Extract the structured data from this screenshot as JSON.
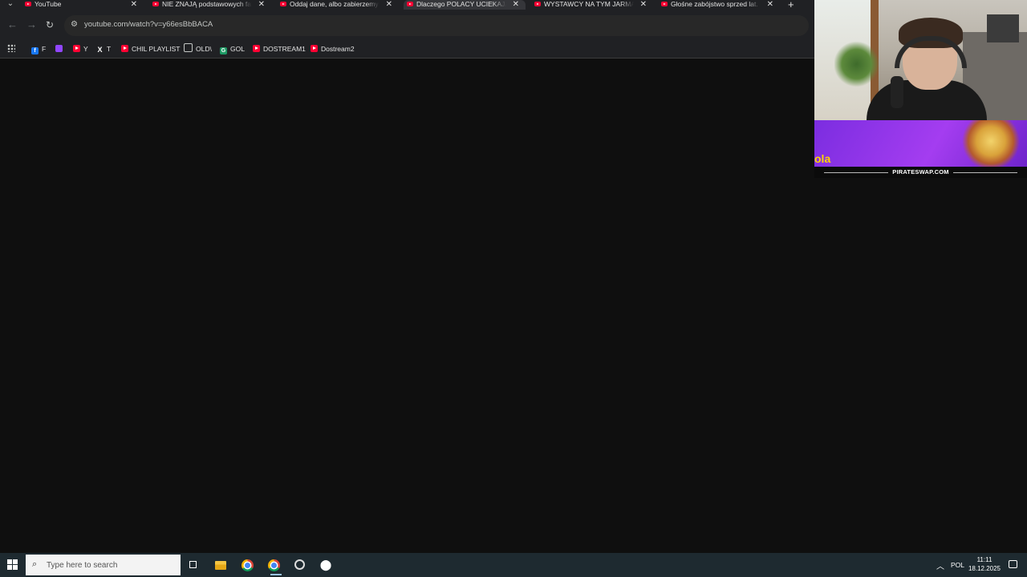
{
  "browser": {
    "tabs": [
      {
        "title": "YouTube",
        "active": false
      },
      {
        "title": "NIE ZNAJĄ podstawowych fakt",
        "active": false
      },
      {
        "title": "Oddaj dane, albo zabierzemy c",
        "active": false
      },
      {
        "title": "Dlaczego POLACY UCIEKAJĄ z",
        "active": true
      },
      {
        "title": "WYSTAWCY NA TYM JARMARK",
        "active": false
      },
      {
        "title": "Głośne zabójstwo sprzed lat. Po",
        "active": false
      }
    ],
    "url": "youtube.com/watch?v=y66esBbBACA",
    "bookmarks": [
      {
        "label": "F",
        "icon": "facebook-icon"
      },
      {
        "label": "",
        "icon": "twitch-icon"
      },
      {
        "label": "Y",
        "icon": "youtube-icon"
      },
      {
        "label": "T",
        "icon": "x-icon"
      },
      {
        "label": "CHIL PLAYLIST",
        "icon": "youtube-icon"
      },
      {
        "label": "OLD\\",
        "icon": "folder-icon"
      },
      {
        "label": "GOL",
        "icon": "g-icon"
      },
      {
        "label": "DOSTREAM1",
        "icon": "youtube-icon"
      },
      {
        "label": "Dostream2",
        "icon": "youtube-icon"
      }
    ]
  },
  "overlay": {
    "banner_text": "PIRATESWAP.COM",
    "banner_logo": "ola"
  },
  "taskbar": {
    "search_placeholder": "Type here to search",
    "language": "POL",
    "time": "11:11",
    "date": "18.12.2025"
  },
  "colors": {
    "tab_bg": "#202124",
    "active_tab": "#35363a",
    "content_bg": "#0f0f0f",
    "youtube_red": "#ff0033",
    "taskbar_bg": "#1e2a30",
    "banner_purple": "#7b2de0"
  }
}
